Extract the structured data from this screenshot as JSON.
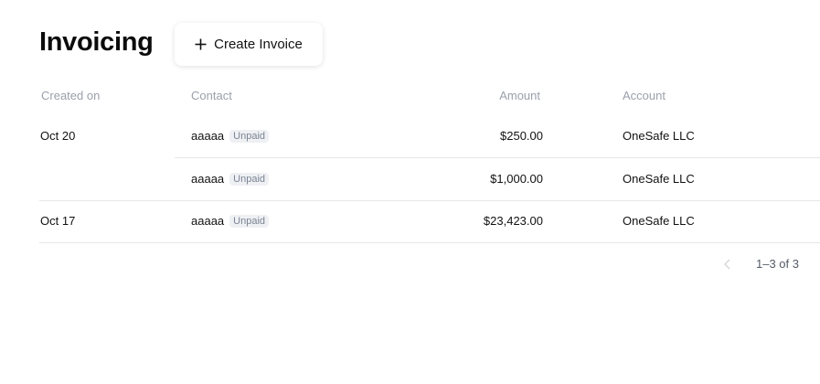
{
  "header": {
    "title": "Invoicing",
    "create_button_label": "Create Invoice"
  },
  "table": {
    "columns": {
      "created_on": "Created on",
      "contact": "Contact",
      "amount": "Amount",
      "account": "Account"
    },
    "rows": [
      {
        "created_on": "Oct 20",
        "contact": "aaaaa",
        "status": "Unpaid",
        "amount": "$250.00",
        "account": "OneSafe LLC"
      },
      {
        "created_on": "",
        "contact": "aaaaa",
        "status": "Unpaid",
        "amount": "$1,000.00",
        "account": "OneSafe LLC"
      },
      {
        "created_on": "Oct 17",
        "contact": "aaaaa",
        "status": "Unpaid",
        "amount": "$23,423.00",
        "account": "OneSafe LLC"
      }
    ]
  },
  "pagination": {
    "range_text": "1–3 of 3"
  },
  "icons": {
    "create": "plus-icon",
    "prev": "chevron-left-icon"
  },
  "colors": {
    "header_text": "#9aa0aa",
    "badge_bg": "#eef0f3",
    "badge_text": "#7c8494",
    "divider": "#e6e7ea"
  }
}
